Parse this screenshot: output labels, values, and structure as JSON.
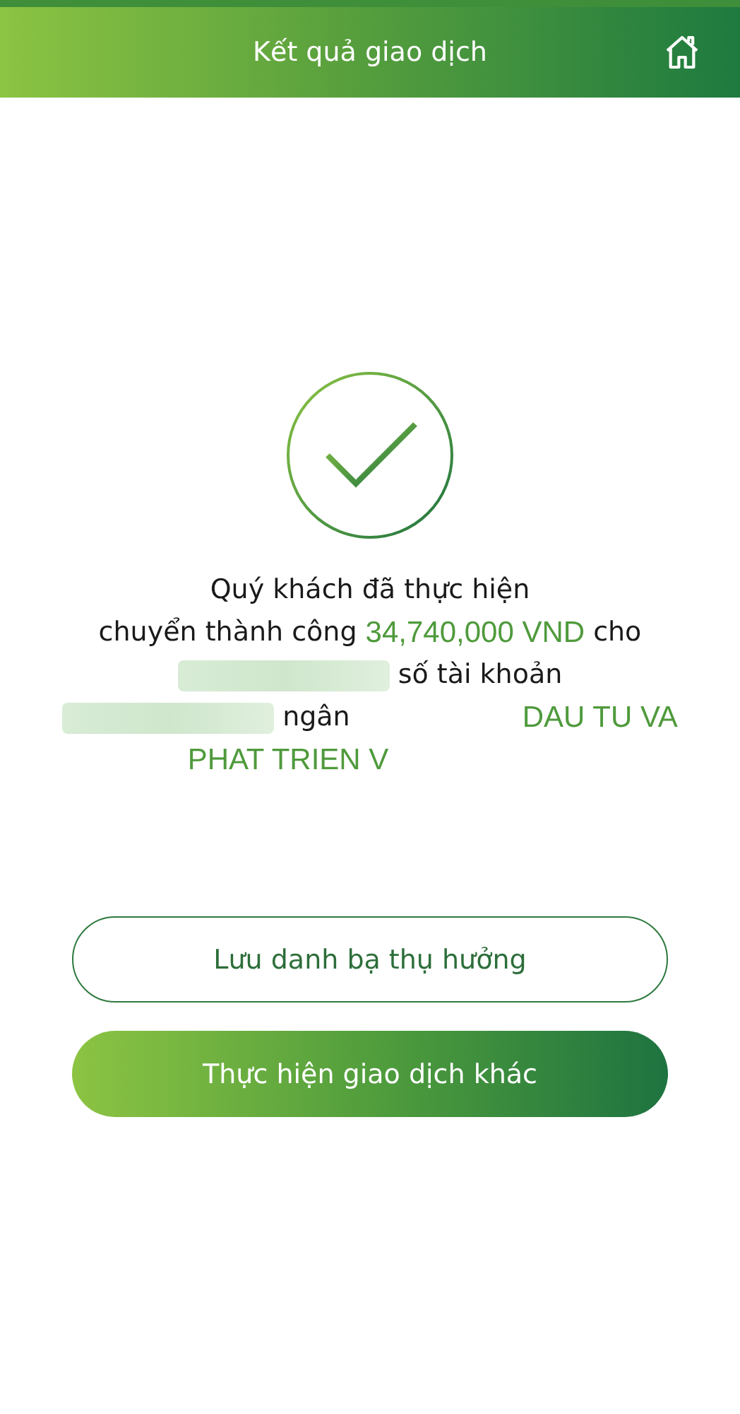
{
  "header": {
    "title": "Kết quả giao dịch"
  },
  "message": {
    "lines": [
      [
        {
          "kind": "text",
          "text": "Quý khách đã thực hiện"
        }
      ],
      [
        {
          "kind": "text",
          "text": "chuyển thành công"
        },
        {
          "kind": "highlight",
          "text": "34,740,000 VND"
        },
        {
          "kind": "text",
          "text": "cho"
        }
      ],
      [
        {
          "kind": "redacted"
        },
        {
          "kind": "text",
          "text": "số tài khoản"
        }
      ],
      [
        {
          "kind": "redacted"
        },
        {
          "kind": "text",
          "text": "ngân"
        },
        {
          "kind": "covered"
        },
        {
          "kind": "highlight",
          "text": "DAU TU VA"
        }
      ],
      [
        {
          "kind": "highlight",
          "text": "PHAT TRIEN V"
        },
        {
          "kind": "covered"
        }
      ]
    ]
  },
  "buttons": [
    {
      "label": "Lưu danh bạ thụ hưởng",
      "kind": "outline"
    },
    {
      "label": "Thực hiện giao dịch khác",
      "kind": "filled"
    }
  ]
}
